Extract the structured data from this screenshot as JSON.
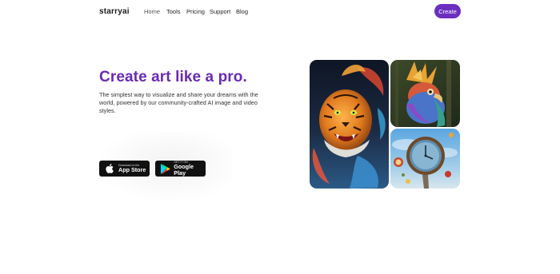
{
  "nav": {
    "logo": "starryai",
    "links": [
      "Home",
      "Tools",
      "Pricing",
      "Support",
      "Blog"
    ],
    "create_label": "Create"
  },
  "hero": {
    "title": "Create art like a pro.",
    "subtitle": "The simplest way to visualize and share your dreams with the world, powered by our community-crafted AI image and video styles."
  },
  "stores": {
    "app_store_small": "Download on the",
    "app_store_big": "App Store",
    "play_small": "GET IT ON",
    "play_big": "Google Play"
  },
  "colors": {
    "brand": "#6b2fc0",
    "title": "#6a2ab1"
  },
  "gallery": [
    {
      "name": "tiger-artwork"
    },
    {
      "name": "bird-artwork"
    },
    {
      "name": "clock-artwork"
    }
  ]
}
